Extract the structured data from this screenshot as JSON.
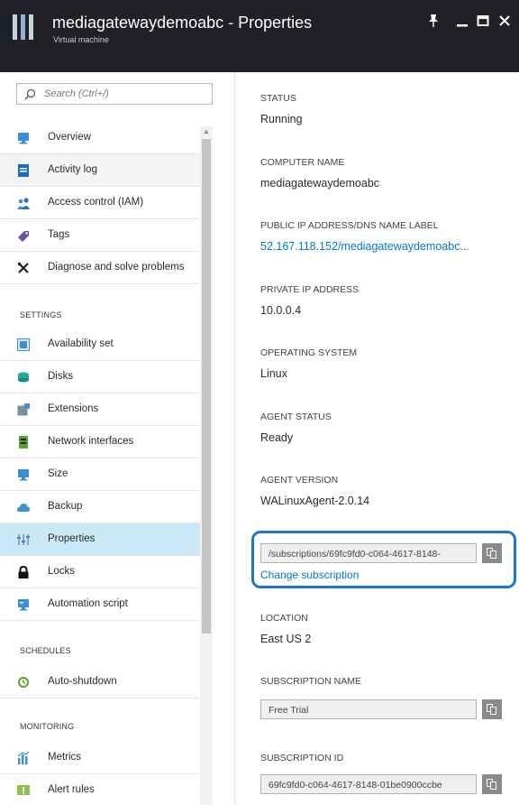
{
  "header": {
    "title": "mediagatewaydemoabc - Properties",
    "subtitle": "Virtual machine",
    "pin_glyph": "📌",
    "minimize_glyph": "_",
    "maximize_glyph": "☐",
    "close_glyph": "✕"
  },
  "search": {
    "placeholder": "Search (Ctrl+/)"
  },
  "nav": {
    "items": [
      {
        "label": "Overview",
        "icon": "monitor-icon",
        "color": "#3b8fd6"
      },
      {
        "label": "Activity log",
        "icon": "activity-log-icon",
        "color": "#1d6fb5"
      },
      {
        "label": "Access control (IAM)",
        "icon": "people-icon",
        "color": "#3b8fd6"
      },
      {
        "label": "Tags",
        "icon": "tag-icon",
        "color": "#6b4fa8"
      },
      {
        "label": "Diagnose and solve problems",
        "icon": "wrench-icon",
        "color": "#222222"
      }
    ],
    "settings_header": "SETTINGS",
    "settings_items": [
      {
        "label": "Availability set",
        "icon": "availability-set-icon",
        "color": "#3b8fd6"
      },
      {
        "label": "Disks",
        "icon": "disks-icon",
        "color": "#2aa9a0"
      },
      {
        "label": "Extensions",
        "icon": "extensions-icon",
        "color": "#3b8fd6"
      },
      {
        "label": "Network interfaces",
        "icon": "network-interface-icon",
        "color": "#5aa02c"
      },
      {
        "label": "Size",
        "icon": "monitor-icon",
        "color": "#3b8fd6"
      },
      {
        "label": "Backup",
        "icon": "cloud-backup-icon",
        "color": "#3b8fd6"
      },
      {
        "label": "Properties",
        "icon": "properties-icon",
        "color": "#7fa7d1"
      },
      {
        "label": "Locks",
        "icon": "lock-icon",
        "color": "#111111"
      },
      {
        "label": "Automation script",
        "icon": "script-icon",
        "color": "#3b8fd6"
      }
    ],
    "schedules_header": "SCHEDULES",
    "schedules_items": [
      {
        "label": "Auto-shutdown",
        "icon": "clock-icon",
        "color": "#5aa02c"
      }
    ],
    "monitoring_header": "MONITORING",
    "monitoring_items": [
      {
        "label": "Metrics",
        "icon": "metrics-icon",
        "color": "#3b8fd6"
      },
      {
        "label": "Alert rules",
        "icon": "alert-rules-icon",
        "color": "#8bc34a"
      }
    ]
  },
  "properties": {
    "status_label": "STATUS",
    "status_value": "Running",
    "computer_name_label": "COMPUTER NAME",
    "computer_name_value": "mediagatewaydemoabc",
    "public_ip_label": "PUBLIC IP ADDRESS/DNS NAME LABEL",
    "public_ip_value": "52.167.118.152/mediagatewaydemoabc...",
    "private_ip_label": "PRIVATE IP ADDRESS",
    "private_ip_value": "10.0.0.4",
    "os_label": "OPERATING SYSTEM",
    "os_value": "Linux",
    "agent_status_label": "AGENT STATUS",
    "agent_status_value": "Ready",
    "agent_version_label": "AGENT VERSION",
    "agent_version_value": "WALinuxAgent-2.0.14",
    "resource_id_value": "/subscriptions/69fc9fd0-c064-4617-8148-",
    "change_subscription_link": "Change subscription",
    "location_label": "LOCATION",
    "location_value": "East US 2",
    "subscription_name_label": "SUBSCRIPTION NAME",
    "subscription_name_value": "Free Trial",
    "subscription_id_label": "SUBSCRIPTION ID",
    "subscription_id_value": "69fc9fd0-c064-4617-8148-01be0900ccbe"
  },
  "colors": {
    "header_bg": "#1f2124",
    "active_item_bg": "#cbe8f6",
    "link": "#0078d4",
    "highlight_border": "#1d77c6"
  }
}
